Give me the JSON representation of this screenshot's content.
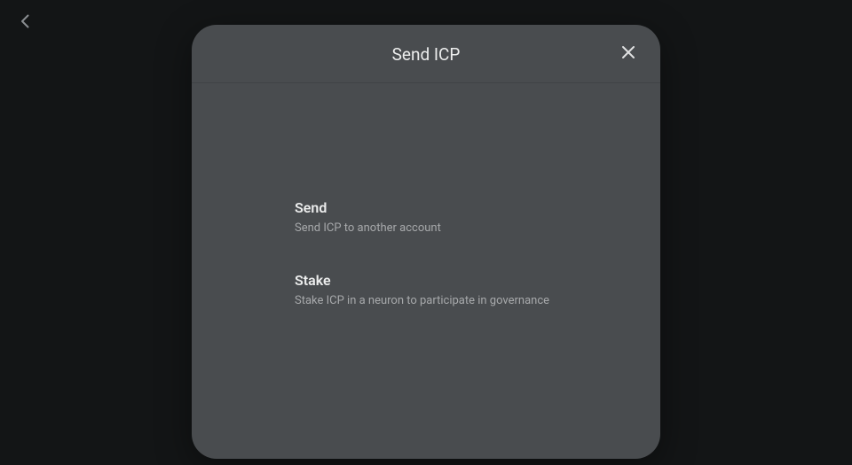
{
  "header": {
    "back": "Back"
  },
  "modal": {
    "title": "Send ICP",
    "close": "Close",
    "options": [
      {
        "title": "Send",
        "desc": "Send ICP to another account"
      },
      {
        "title": "Stake",
        "desc": "Stake ICP in a neuron to participate in governance"
      }
    ]
  }
}
